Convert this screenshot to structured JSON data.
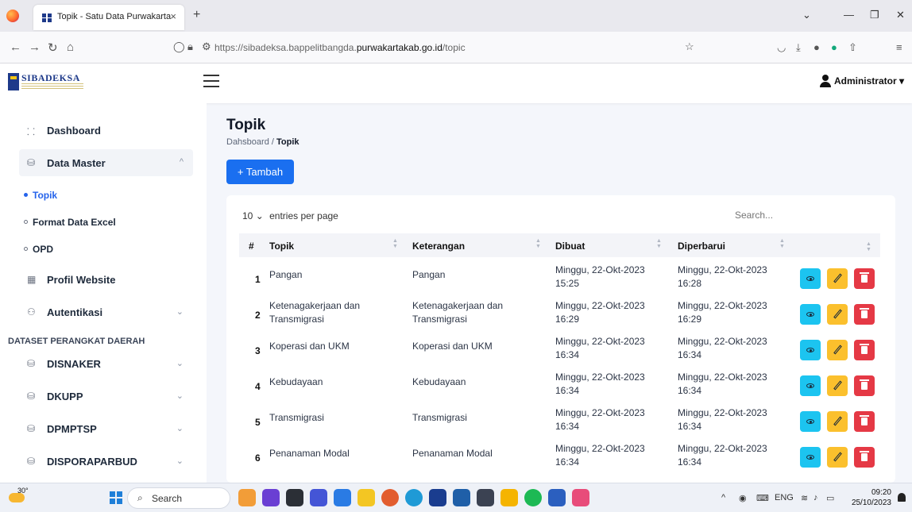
{
  "browser": {
    "tab_title": "Topik - Satu Data Purwakarta",
    "tab_close": "×",
    "new_tab": "+",
    "url_prefix": "https://sibadeksa.bappelitbangda.",
    "url_domain": "purwakartakab.go.id",
    "url_path": "/topic"
  },
  "header": {
    "logo_text": "SIBADEKSA",
    "user_name": "Administrator ▾"
  },
  "sidebar": {
    "items": [
      {
        "label": "Dashboard",
        "icon": "grid-icon"
      },
      {
        "label": "Data Master",
        "icon": "database-icon",
        "chevron": "^"
      },
      {
        "label": "Profil Website",
        "icon": "building-icon"
      },
      {
        "label": "Autentikasi",
        "icon": "users-icon",
        "chevron": "⌄"
      }
    ],
    "sub_items": [
      "Topik",
      "Format Data Excel",
      "OPD"
    ],
    "section_heading": "DATASET PERANGKAT DAERAH",
    "datasets": [
      {
        "label": "DISNAKER",
        "chevron": "⌄"
      },
      {
        "label": "DKUPP",
        "chevron": "⌄"
      },
      {
        "label": "DPMPTSP",
        "chevron": "⌄"
      },
      {
        "label": "DISPORAPARBUD",
        "chevron": "⌄"
      }
    ]
  },
  "main": {
    "title": "Topik",
    "breadcrumb_home": "Dahsboard",
    "breadcrumb_sep": "/",
    "breadcrumb_current": "Topik",
    "add_button": "+ Tambah",
    "per_page_value": "10",
    "per_page_label": "entries per page",
    "search_placeholder": "Search...",
    "columns": [
      "#",
      "Topik",
      "Keterangan",
      "Dibuat",
      "Diperbarui"
    ],
    "rows": [
      {
        "no": "1",
        "topik": [
          "Pangan"
        ],
        "keterangan": [
          "Pangan"
        ],
        "dibuat": [
          "Minggu, 22-Okt-2023",
          "15:25"
        ],
        "diperbarui": [
          "Minggu, 22-Okt-2023",
          "16:28"
        ]
      },
      {
        "no": "2",
        "topik": [
          "Ketenagakerjaan dan",
          "Transmigrasi"
        ],
        "keterangan": [
          "Ketenagakerjaan dan",
          "Transmigrasi"
        ],
        "dibuat": [
          "Minggu, 22-Okt-2023",
          "16:29"
        ],
        "diperbarui": [
          "Minggu, 22-Okt-2023",
          "16:29"
        ]
      },
      {
        "no": "3",
        "topik": [
          "Koperasi dan UKM"
        ],
        "keterangan": [
          "Koperasi dan UKM"
        ],
        "dibuat": [
          "Minggu, 22-Okt-2023",
          "16:34"
        ],
        "diperbarui": [
          "Minggu, 22-Okt-2023",
          "16:34"
        ]
      },
      {
        "no": "4",
        "topik": [
          "Kebudayaan"
        ],
        "keterangan": [
          "Kebudayaan"
        ],
        "dibuat": [
          "Minggu, 22-Okt-2023",
          "16:34"
        ],
        "diperbarui": [
          "Minggu, 22-Okt-2023",
          "16:34"
        ]
      },
      {
        "no": "5",
        "topik": [
          "Transmigrasi"
        ],
        "keterangan": [
          "Transmigrasi"
        ],
        "dibuat": [
          "Minggu, 22-Okt-2023",
          "16:34"
        ],
        "diperbarui": [
          "Minggu, 22-Okt-2023",
          "16:34"
        ]
      },
      {
        "no": "6",
        "topik": [
          "Penanaman Modal"
        ],
        "keterangan": [
          "Penanaman Modal"
        ],
        "dibuat": [
          "Minggu, 22-Okt-2023",
          "16:34"
        ],
        "diperbarui": [
          "Minggu, 22-Okt-2023",
          "16:34"
        ]
      }
    ]
  },
  "taskbar": {
    "temperature": "30°",
    "search_label": "Search",
    "lang": "ENG",
    "time": "09:20",
    "date": "25/10/2023"
  },
  "colors": {
    "primary": "#1a6ff0",
    "view": "#1cc4f0",
    "edit": "#fbc02d",
    "delete": "#e53945",
    "active_link": "#2563eb"
  }
}
